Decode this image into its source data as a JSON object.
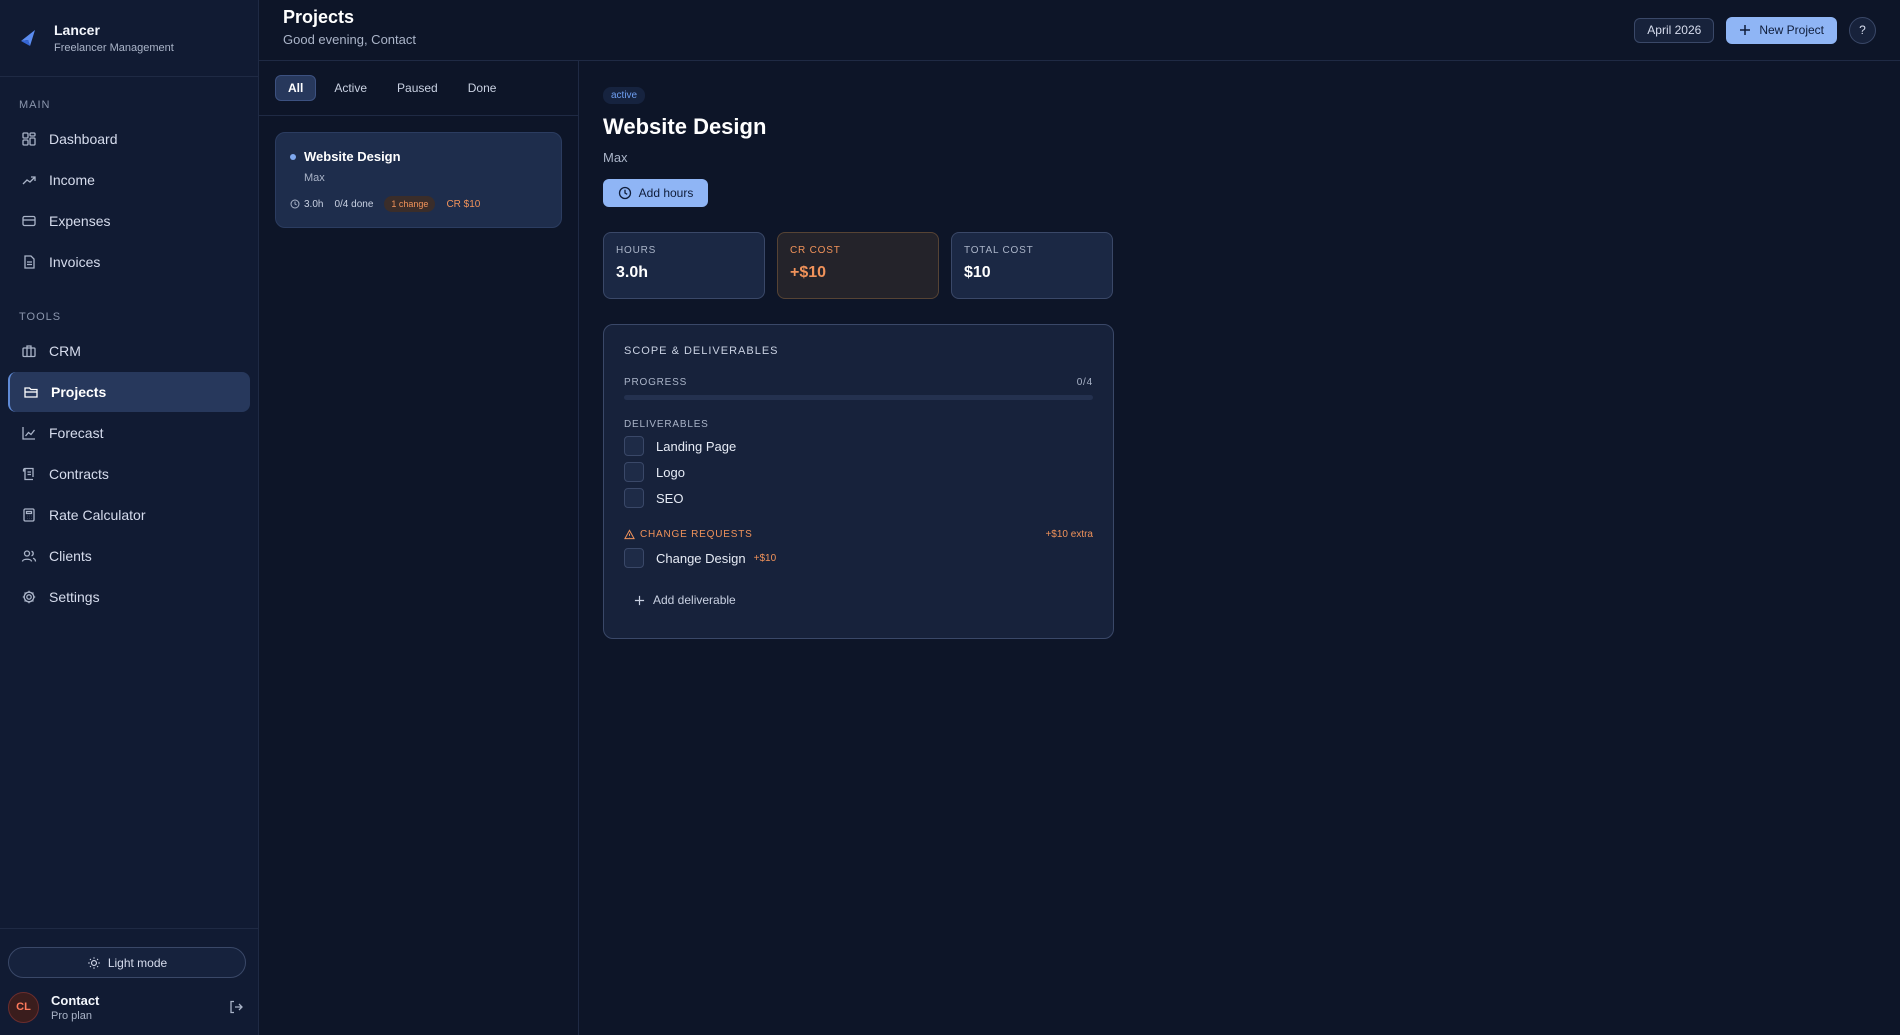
{
  "brand": {
    "name": "Lancer",
    "subtitle": "Freelancer Management"
  },
  "sidebar": {
    "sections": [
      {
        "label": "MAIN",
        "items": [
          {
            "label": "Dashboard",
            "icon": "dashboard-icon"
          },
          {
            "label": "Income",
            "icon": "trending-up-icon"
          },
          {
            "label": "Expenses",
            "icon": "card-icon"
          },
          {
            "label": "Invoices",
            "icon": "document-icon"
          }
        ]
      },
      {
        "label": "TOOLS",
        "items": [
          {
            "label": "CRM",
            "icon": "briefcase-icon"
          },
          {
            "label": "Projects",
            "icon": "folder-icon",
            "active": true
          },
          {
            "label": "Forecast",
            "icon": "line-chart-icon"
          },
          {
            "label": "Contracts",
            "icon": "scroll-icon"
          },
          {
            "label": "Rate Calculator",
            "icon": "calculator-icon"
          },
          {
            "label": "Clients",
            "icon": "users-icon"
          },
          {
            "label": "Settings",
            "icon": "gear-icon"
          }
        ]
      }
    ],
    "theme_toggle": "Light mode",
    "user": {
      "initials": "CL",
      "name": "Contact",
      "plan": "Pro plan"
    }
  },
  "header": {
    "title": "Projects",
    "greeting": "Good evening, Contact",
    "month": "April 2026",
    "new_project": "New Project",
    "help": "?"
  },
  "filters": [
    "All",
    "Active",
    "Paused",
    "Done"
  ],
  "project_list": [
    {
      "title": "Website Design",
      "client": "Max",
      "hours": "3.0h",
      "done": "0/4 done",
      "badge": "1 change",
      "cr": "CR $10"
    }
  ],
  "detail": {
    "status": "active",
    "title": "Website Design",
    "client": "Max",
    "add_hours": "Add hours",
    "stats": {
      "hours": {
        "label": "HOURS",
        "value": "3.0h"
      },
      "cr_cost": {
        "label": "CR COST",
        "value": "+$10"
      },
      "total_cost": {
        "label": "TOTAL COST",
        "value": "$10"
      }
    },
    "scope": {
      "title": "SCOPE & DELIVERABLES",
      "progress_label": "PROGRESS",
      "progress_text": "0/4",
      "progress_fraction": 0,
      "deliverables_label": "DELIVERABLES",
      "deliverables": [
        "Landing Page",
        "Logo",
        "SEO"
      ],
      "change_requests_label": "CHANGE REQUESTS",
      "change_requests_extra": "+$10 extra",
      "change_requests": [
        {
          "label": "Change Design",
          "cost": "+$10"
        }
      ],
      "add_deliverable": "Add deliverable"
    }
  },
  "colors": {
    "accent": "#8fb5f5",
    "warning": "#f0925a",
    "background": "#0d1528"
  }
}
